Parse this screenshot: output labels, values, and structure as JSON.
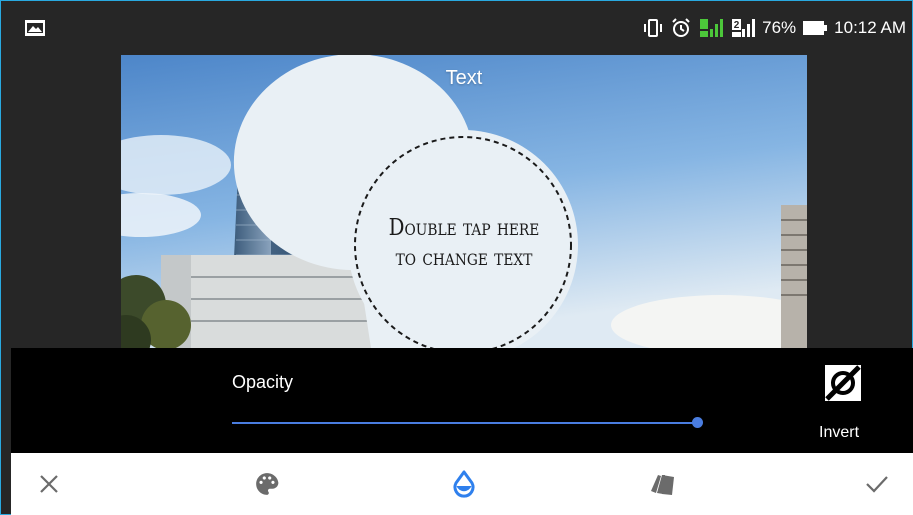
{
  "status_bar": {
    "battery_percent": "76%",
    "time": "10:12 AM",
    "icons": [
      "gallery-notification-icon",
      "vibrate-icon",
      "alarm-icon",
      "signal-sim1-icon",
      "signal-sim2-icon",
      "battery-icon"
    ],
    "sim2_label": "2"
  },
  "photo": {
    "title": "Text",
    "bubble_line1": "Double tap here",
    "bubble_line2": "to change text"
  },
  "panel": {
    "opacity_label": "Opacity",
    "opacity_value": 1.0,
    "invert_label": "Invert"
  },
  "toolbar": {
    "items": [
      "close-icon",
      "palette-icon",
      "opacity-drop-icon",
      "style-cards-icon",
      "check-icon"
    ],
    "active_item": "opacity-drop-icon"
  },
  "colors": {
    "accent": "#4a7de0",
    "active_icon": "#2f80ed",
    "signal_green": "#4cc73a",
    "frame_border": "#29a9e0"
  }
}
